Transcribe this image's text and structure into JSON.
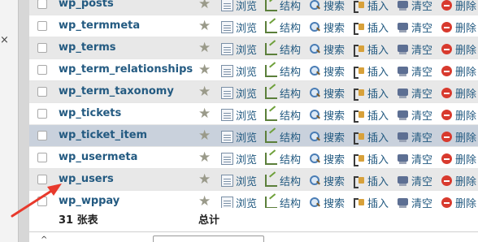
{
  "actions": {
    "browse": "浏览",
    "structure": "结构",
    "search": "搜索",
    "insert": "插入",
    "empty": "清空",
    "drop": "删除"
  },
  "tables": [
    {
      "name": "wp_posts"
    },
    {
      "name": "wp_termmeta"
    },
    {
      "name": "wp_terms"
    },
    {
      "name": "wp_term_relationships"
    },
    {
      "name": "wp_term_taxonomy"
    },
    {
      "name": "wp_tickets"
    },
    {
      "name": "wp_ticket_item"
    },
    {
      "name": "wp_usermeta"
    },
    {
      "name": "wp_users"
    },
    {
      "name": "wp_wppay"
    }
  ],
  "summary": {
    "count_label": "31 张表",
    "total_label": "总计"
  },
  "bottom": {
    "glyph": "^"
  },
  "colors": {
    "link": "#235a81",
    "highlight_row": "#c9d1dc",
    "arrow": "#e8392c"
  }
}
